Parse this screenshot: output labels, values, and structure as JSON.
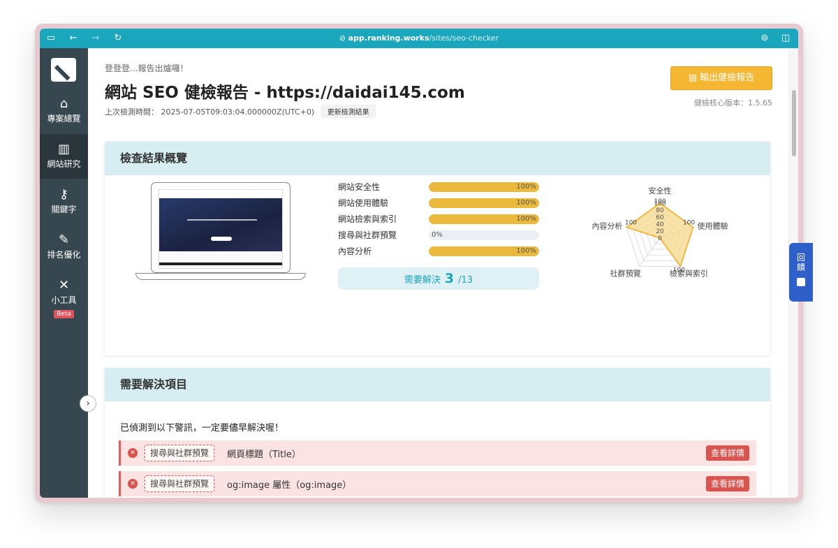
{
  "browser": {
    "url_host": "app.ranking.works",
    "url_path": "/sites/seo-checker",
    "icons": [
      "sidebar-toggle-icon",
      "back-icon",
      "forward-icon",
      "reload-icon",
      "lock-icon",
      "reader-icon",
      "split-view-icon"
    ]
  },
  "sidebar": {
    "items": [
      {
        "label": "專案總覽",
        "icon": "home-icon"
      },
      {
        "label": "網站研究",
        "icon": "monitor-icon"
      },
      {
        "label": "關鍵字",
        "icon": "key-icon"
      },
      {
        "label": "排名優化",
        "icon": "tools-icon"
      },
      {
        "label": "小工具",
        "icon": "wrench-icon",
        "badge": "Beta"
      }
    ],
    "active_index": 1
  },
  "header": {
    "subtitle": "登登登...報告出爐囉！",
    "title": "網站 SEO 健檢報告 - https://daidai145.com",
    "last_scan_label": "上次檢測時間：",
    "last_scan_value": "2025-07-05T09:03:04.000000Z(UTC+0)",
    "refresh_label": "更新檢測結果",
    "export_label": "輸出健檢報告",
    "version": "健檢核心版本：1.5.65"
  },
  "overview": {
    "title": "檢查結果概覽",
    "metrics": [
      {
        "label": "網站安全性",
        "value": 100,
        "display": "100%"
      },
      {
        "label": "網站使用體驗",
        "value": 100,
        "display": "100%"
      },
      {
        "label": "網站檢索與索引",
        "value": 100,
        "display": "100%"
      },
      {
        "label": "搜尋與社群預覽",
        "value": 0,
        "display": "0%"
      },
      {
        "label": "內容分析",
        "value": 100,
        "display": "100%"
      }
    ],
    "resolve_label": "需要解決",
    "resolve_count": "3",
    "resolve_total": "/13"
  },
  "chart_data": {
    "type": "radar",
    "axes": [
      "安全性",
      "使用體驗",
      "檢索與索引",
      "社群預覽",
      "內容分析"
    ],
    "values": [
      100,
      100,
      100,
      0,
      100
    ],
    "ticks": [
      "100",
      "80",
      "60",
      "40",
      "20",
      "0"
    ],
    "data_labels": [
      "100",
      "100",
      "100",
      "",
      "100"
    ],
    "range": [
      0,
      100
    ],
    "fill_color": "#f7d88a",
    "stroke_color": "#f0b43a"
  },
  "issues_section": {
    "title": "需要解決項目",
    "warning": "已偵測到以下警訊，一定要儘早解決喔！",
    "detail_label": "查看詳情",
    "items": [
      {
        "tag": "搜尋與社群預覽",
        "text": "網頁標題（Title）"
      },
      {
        "tag": "搜尋與社群預覽",
        "text": "og:image 屬性（og:image）"
      }
    ]
  },
  "feedback_label": "回饋"
}
